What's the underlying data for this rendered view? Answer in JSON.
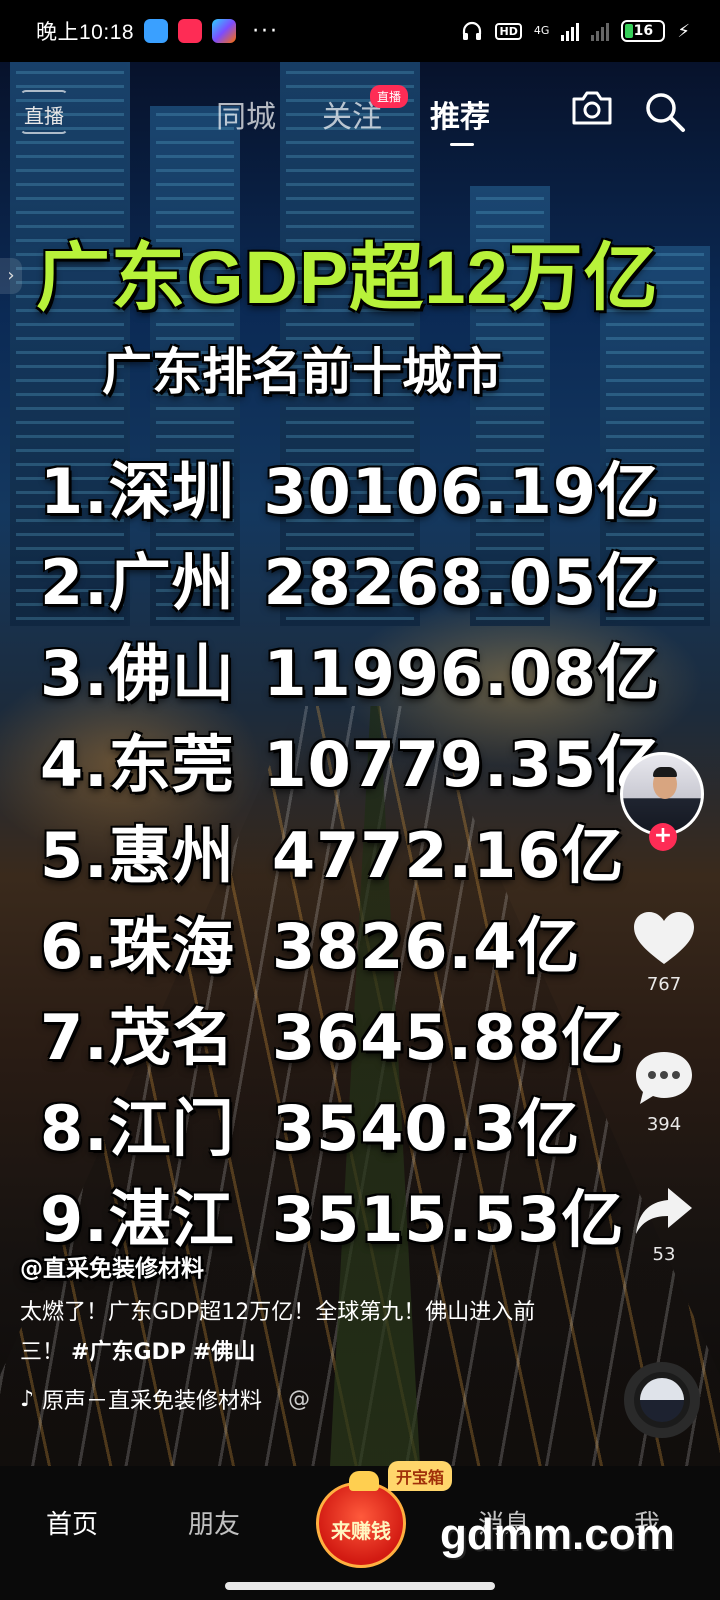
{
  "status_bar": {
    "time": "晚上10:18",
    "more": "···",
    "hd": "HD",
    "network": "4G",
    "battery": "16"
  },
  "top_nav": {
    "live_entry": "直播",
    "tabs": [
      {
        "label": "同城"
      },
      {
        "label": "关注"
      },
      {
        "label": "推荐",
        "active": true
      }
    ],
    "live_badge": "直播"
  },
  "video": {
    "headline": "广东GDP超12万亿",
    "subheadline": "广东排名前十城市",
    "ranking": [
      {
        "city": "1.深圳",
        "value": "30106.19亿"
      },
      {
        "city": "2.广州",
        "value": "28268.05亿"
      },
      {
        "city": "3.佛山",
        "value": "11996.08亿"
      },
      {
        "city": "4.东莞",
        "value": "10779.35亿"
      },
      {
        "city": "5.惠州",
        "value": "4772.16亿"
      },
      {
        "city": "6.珠海",
        "value": "3826.4亿"
      },
      {
        "city": "7.茂名",
        "value": "3645.88亿"
      },
      {
        "city": "8.江门",
        "value": "3540.3亿"
      },
      {
        "city": "9.湛江",
        "value": "3515.53亿"
      }
    ]
  },
  "actions": {
    "likes": "767",
    "comments": "394",
    "shares": "53"
  },
  "caption": {
    "author": "@直采免装修材料",
    "text": "太燃了！广东GDP超12万亿！全球第九！佛山进入前三！",
    "tags": [
      "#广东GDP",
      "#佛山"
    ],
    "music": "原声－直采免装修材料",
    "music_more": "@"
  },
  "bottom_nav": {
    "home": "首页",
    "friends": "朋友",
    "earn": "来赚钱",
    "treasure": "开宝箱",
    "messages": "消息",
    "me": "我"
  },
  "watermark": "gdmm.com",
  "colors": {
    "headline": "#b8f23a",
    "accent": "#fe2c55"
  }
}
